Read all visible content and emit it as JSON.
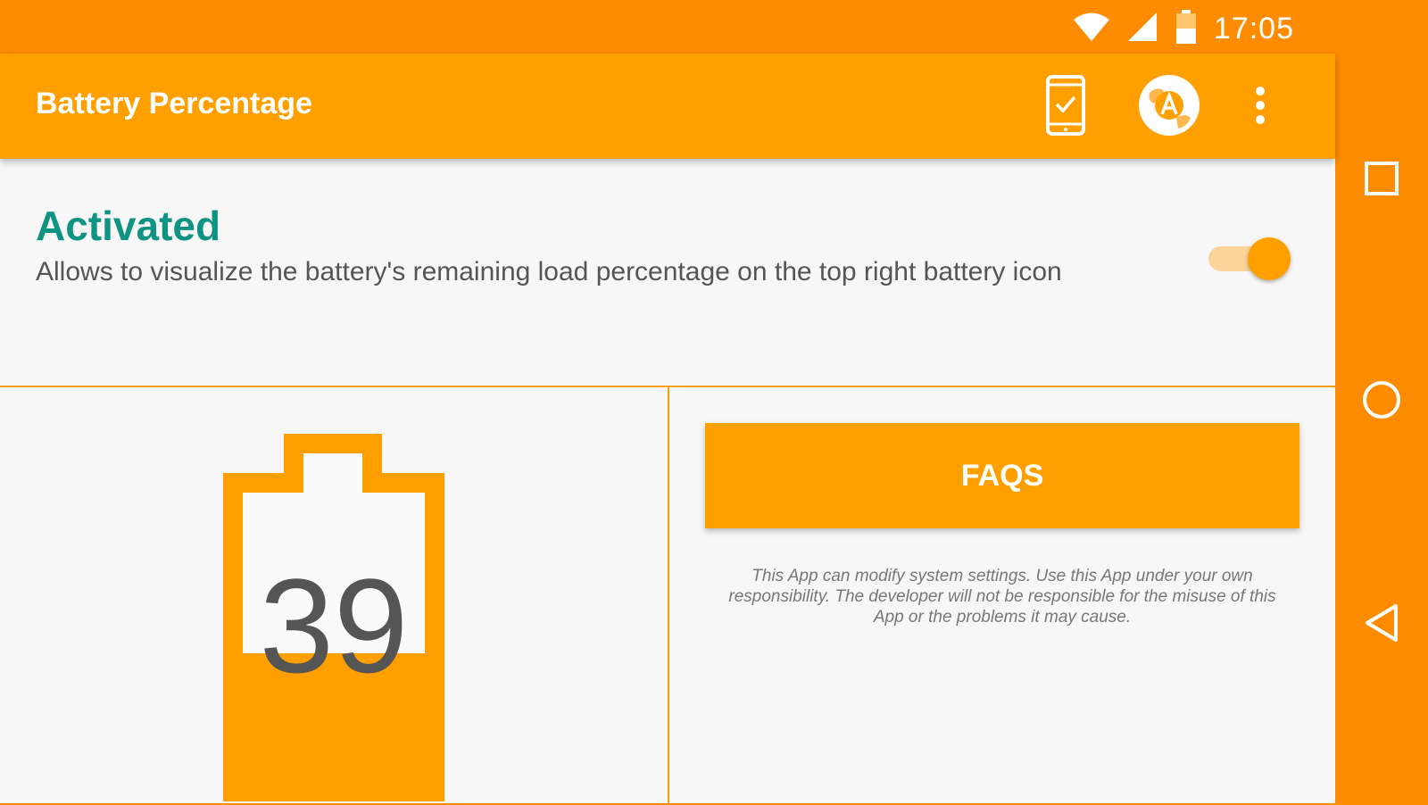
{
  "status_bar": {
    "time": "17:05",
    "icons": [
      "wifi-icon",
      "cell-signal-icon",
      "battery-status-icon"
    ]
  },
  "app_bar": {
    "title": "Battery Percentage",
    "actions": [
      "phone-check-icon",
      "globe-translate-icon",
      "overflow-menu-icon"
    ]
  },
  "activation": {
    "title": "Activated",
    "description": "Allows to visualize the battery's remaining load percentage on the top right battery icon",
    "enabled": true
  },
  "battery": {
    "level": "39",
    "fill_fraction": 0.39
  },
  "faqs_button": {
    "label": "FAQS"
  },
  "disclaimer": {
    "text": "This App can modify system settings. Use this App under your own responsibility. The developer will not be responsible for the misuse of this App or the problems it may cause."
  },
  "navigation": [
    "recent-apps-icon",
    "home-icon",
    "back-icon"
  ],
  "colors": {
    "status_bar": "#ff8c00",
    "accent": "#ffa000",
    "activated_text": "#0f9383",
    "background": "#f7f7f7"
  }
}
